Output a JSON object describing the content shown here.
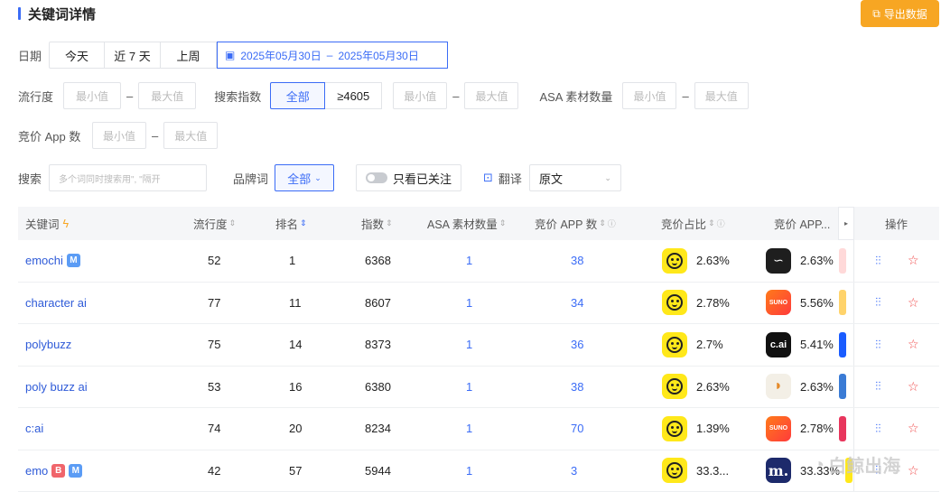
{
  "header": {
    "title": "关键词详情",
    "export_label": "导出数据"
  },
  "filters": {
    "date_label": "日期",
    "date_options": [
      "今天",
      "近 7 天",
      "上周"
    ],
    "date_range_start": "2025年05月30日",
    "date_range_sep": "–",
    "date_range_end": "2025年05月30日",
    "popularity_label": "流行度",
    "min_placeholder": "最小值",
    "max_placeholder": "最大值",
    "search_index_label": "搜索指数",
    "search_index_options": [
      "全部",
      "≥4605"
    ],
    "asa_label": "ASA 素材数量",
    "bid_app_label": "竞价 App 数",
    "search_label": "搜索",
    "search_placeholder": "多个词同时搜索用\", \"隔开",
    "brand_label": "品牌词",
    "brand_value": "全部",
    "follow_label": "只看已关注",
    "translate_label": "翻译",
    "translate_value": "原文"
  },
  "table": {
    "headers": {
      "keyword": "关键词",
      "popularity": "流行度",
      "rank": "排名",
      "index": "指数",
      "asa": "ASA 素材数量",
      "bid_apps": "竞价 APP 数",
      "bid_share": "竞价占比",
      "bid_app_col": "竞价 APP...",
      "actions": "操作"
    },
    "rows": [
      {
        "keyword": "emochi",
        "badges": [
          "M"
        ],
        "popularity": "52",
        "rank": "1",
        "index": "6368",
        "asa": "1",
        "bid_apps": "38",
        "share": "2.63%",
        "app2": "2.63%",
        "app2_icon": "dark"
      },
      {
        "keyword": "character ai",
        "badges": [],
        "popularity": "77",
        "rank": "11",
        "index": "8607",
        "asa": "1",
        "bid_apps": "34",
        "share": "2.78%",
        "app2": "5.56%",
        "app2_icon": "suno"
      },
      {
        "keyword": "polybuzz",
        "badges": [],
        "popularity": "75",
        "rank": "14",
        "index": "8373",
        "asa": "1",
        "bid_apps": "36",
        "share": "2.7%",
        "app2": "5.41%",
        "app2_icon": "cai"
      },
      {
        "keyword": "poly buzz ai",
        "badges": [],
        "popularity": "53",
        "rank": "16",
        "index": "6380",
        "asa": "1",
        "bid_apps": "38",
        "share": "2.63%",
        "app2": "2.63%",
        "app2_icon": "poly"
      },
      {
        "keyword": "c:ai",
        "badges": [],
        "popularity": "74",
        "rank": "20",
        "index": "8234",
        "asa": "1",
        "bid_apps": "70",
        "share": "1.39%",
        "app2": "2.78%",
        "app2_icon": "suno"
      },
      {
        "keyword": "emo",
        "badges": [
          "B",
          "M"
        ],
        "popularity": "42",
        "rank": "57",
        "index": "5944",
        "asa": "1",
        "bid_apps": "3",
        "share": "33.3...",
        "app2": "33.33%",
        "app2_icon": "m"
      }
    ]
  },
  "icon_texts": {
    "suno": "SUNO",
    "cai": "c.ai",
    "m": "m."
  },
  "watermark": "白鲸出海"
}
